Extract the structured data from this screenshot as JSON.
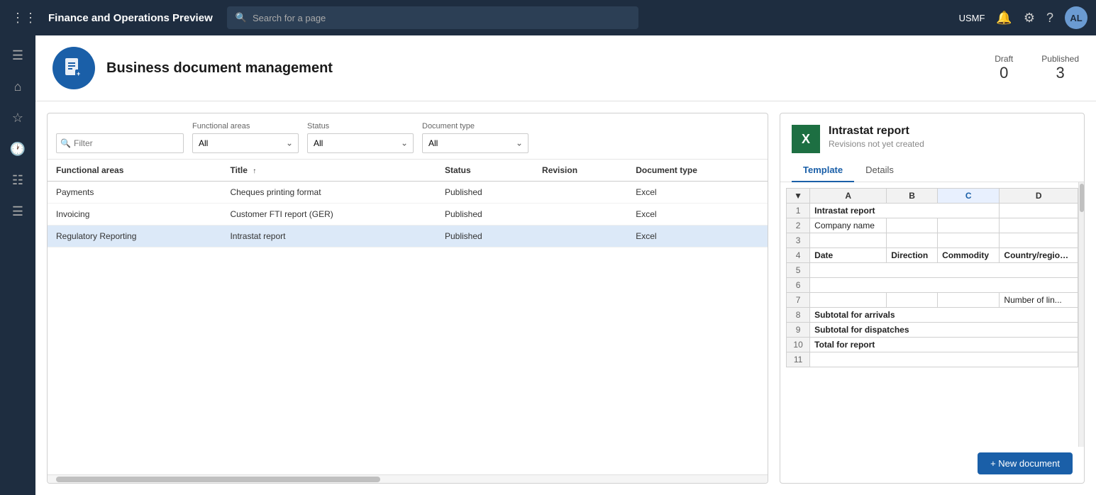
{
  "app": {
    "title": "Finance and Operations Preview",
    "search_placeholder": "Search for a page",
    "user": "USMF",
    "avatar_initials": "AL"
  },
  "sidebar": {
    "icons": [
      "hamburger",
      "home",
      "favorites",
      "recent",
      "modules",
      "list"
    ]
  },
  "page": {
    "title": "Business document management",
    "stats": {
      "draft_label": "Draft",
      "draft_value": "0",
      "published_label": "Published",
      "published_value": "3"
    }
  },
  "filters": {
    "filter_placeholder": "Filter",
    "functional_areas_label": "Functional areas",
    "functional_areas_value": "All",
    "status_label": "Status",
    "status_value": "All",
    "document_type_label": "Document type",
    "document_type_value": "All"
  },
  "table": {
    "columns": [
      {
        "key": "functional_areas",
        "label": "Functional areas"
      },
      {
        "key": "title",
        "label": "Title",
        "sorted": "asc"
      },
      {
        "key": "status",
        "label": "Status"
      },
      {
        "key": "revision",
        "label": "Revision"
      },
      {
        "key": "document_type",
        "label": "Document type"
      }
    ],
    "rows": [
      {
        "functional_areas": "Payments",
        "title": "Cheques printing format",
        "status": "Published",
        "revision": "",
        "document_type": "Excel",
        "selected": false
      },
      {
        "functional_areas": "Invoicing",
        "title": "Customer FTI report (GER)",
        "status": "Published",
        "revision": "",
        "document_type": "Excel",
        "selected": false
      },
      {
        "functional_areas": "Regulatory Reporting",
        "title": "Intrastat report",
        "status": "Published",
        "revision": "",
        "document_type": "Excel",
        "selected": true
      }
    ]
  },
  "preview": {
    "icon_letter": "X",
    "title": "Intrastat report",
    "subtitle": "Revisions not yet created",
    "tabs": [
      "Template",
      "Details"
    ],
    "active_tab": "Template",
    "excel": {
      "col_headers": [
        "",
        "A",
        "B",
        "C",
        "D"
      ],
      "active_col": "C",
      "rows": [
        {
          "row_num": "1",
          "cells": [
            "Intrastat report",
            "",
            "",
            ""
          ]
        },
        {
          "row_num": "2",
          "cells": [
            "Company name",
            "",
            "",
            ""
          ]
        },
        {
          "row_num": "3",
          "cells": [
            "",
            "",
            "",
            ""
          ]
        },
        {
          "row_num": "4",
          "cells": [
            "Date",
            "Direction",
            "Commodity",
            "Country/region c... destination"
          ]
        },
        {
          "row_num": "5",
          "cells": [
            "",
            "",
            "",
            ""
          ]
        },
        {
          "row_num": "6",
          "cells": [
            "",
            "",
            "",
            ""
          ]
        },
        {
          "row_num": "7",
          "cells": [
            "",
            "",
            "",
            "Number of lin..."
          ]
        },
        {
          "row_num": "8",
          "cells": [
            "Subtotal for arrivals",
            "",
            "",
            ""
          ]
        },
        {
          "row_num": "9",
          "cells": [
            "Subtotal for dispatches",
            "",
            "",
            ""
          ]
        },
        {
          "row_num": "10",
          "cells": [
            "Total for report",
            "",
            "",
            ""
          ]
        },
        {
          "row_num": "11",
          "cells": [
            "",
            "",
            "",
            ""
          ]
        }
      ]
    },
    "new_document_label": "+ New document"
  }
}
